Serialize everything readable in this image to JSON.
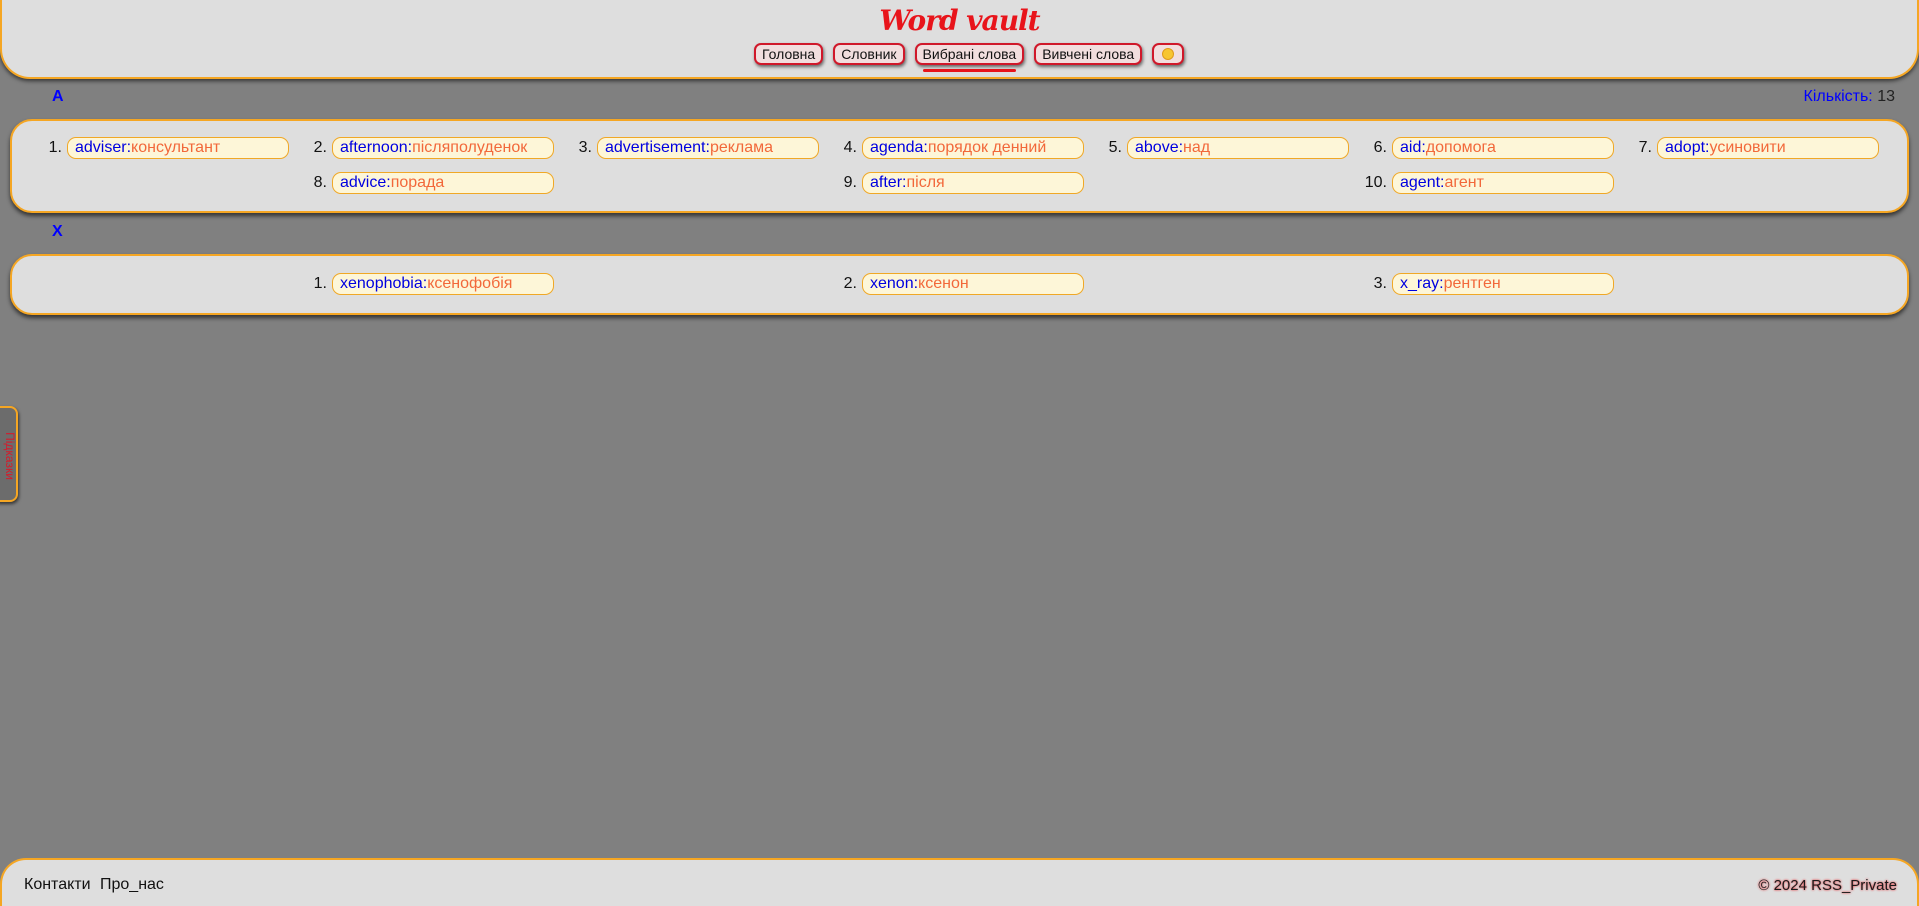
{
  "header": {
    "logo": "Word vault",
    "nav": [
      {
        "label": "Головна"
      },
      {
        "label": "Словник"
      },
      {
        "label": "Вибрані слова",
        "active": true
      },
      {
        "label": "Вивчені слова"
      }
    ],
    "theme_icon": "sun-icon"
  },
  "summary": {
    "count_label": "Кількість:",
    "count_value": "13"
  },
  "groups": [
    {
      "letter": "A",
      "words": [
        {
          "num": "1.",
          "en": "adviser",
          "uk": "консультант"
        },
        {
          "num": "2.",
          "en": "afternoon",
          "uk": "післяполуденок"
        },
        {
          "num": "3.",
          "en": "advertisement",
          "uk": "реклама"
        },
        {
          "num": "4.",
          "en": "agenda",
          "uk": "порядок денний"
        },
        {
          "num": "5.",
          "en": "above",
          "uk": "над"
        },
        {
          "num": "6.",
          "en": "aid",
          "uk": "допомога"
        },
        {
          "num": "7.",
          "en": "adopt",
          "uk": "усиновити"
        },
        {
          "num": "8.",
          "en": "advice",
          "uk": "порада"
        },
        {
          "num": "9.",
          "en": "after",
          "uk": "після"
        },
        {
          "num": "10.",
          "en": "agent",
          "uk": "агент"
        }
      ]
    },
    {
      "letter": "X",
      "words": [
        {
          "num": "1.",
          "en": "xenophobia",
          "uk": "ксенофобія"
        },
        {
          "num": "2.",
          "en": "xenon",
          "uk": "ксенон"
        },
        {
          "num": "3.",
          "en": "x_ray",
          "uk": "рентген"
        }
      ]
    }
  ],
  "side_tab": {
    "label": "Підказки"
  },
  "footer": {
    "links": [
      "Контакти",
      "Про_нас"
    ],
    "copyright": "© 2024 RSS_Private"
  },
  "colors": {
    "accent": "#f5a623",
    "brand_red": "#e8141b",
    "word_en": "#0000e0",
    "word_uk": "#f2683a",
    "background": "#808080",
    "panel": "#dedede"
  }
}
